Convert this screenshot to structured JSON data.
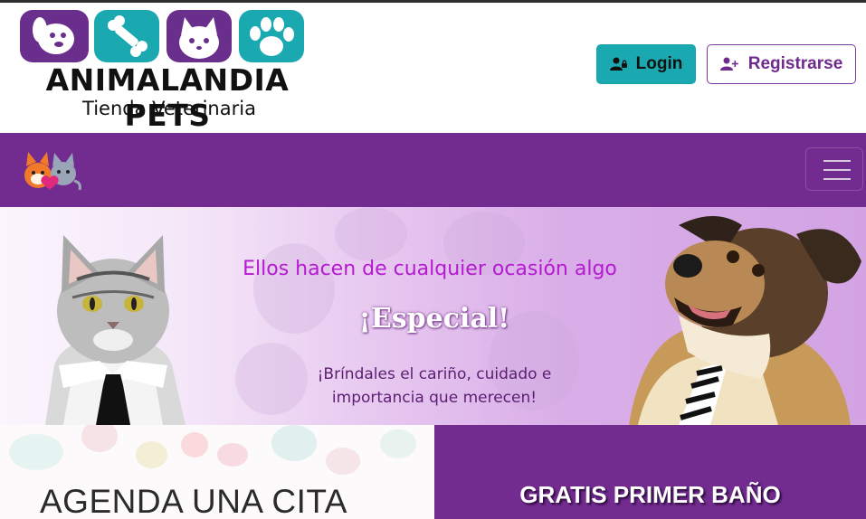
{
  "brand": {
    "name": "ANIMALANDIA PETS",
    "subtitle": "Tienda Veterinaria"
  },
  "header": {
    "login_label": "Login",
    "register_label": "Registrarse"
  },
  "navbar": {
    "brand_icon": "kittens-love-icon",
    "toggle_icon": "hamburger-menu-icon"
  },
  "banner": {
    "line1": "Ellos hacen de cualquier ocasión algo",
    "line2": "¡Especial!",
    "line3a": "¡Bríndales el cariño, cuidado e",
    "line3b": "importancia que merecen!"
  },
  "panels": {
    "left_title": "AGENDA UNA CITA",
    "right_title": "GRATIS PRIMER BAÑO"
  },
  "colors": {
    "primary_purple": "#722b8f",
    "teal": "#1aa9b0",
    "banner_text": "#b51ad1"
  }
}
